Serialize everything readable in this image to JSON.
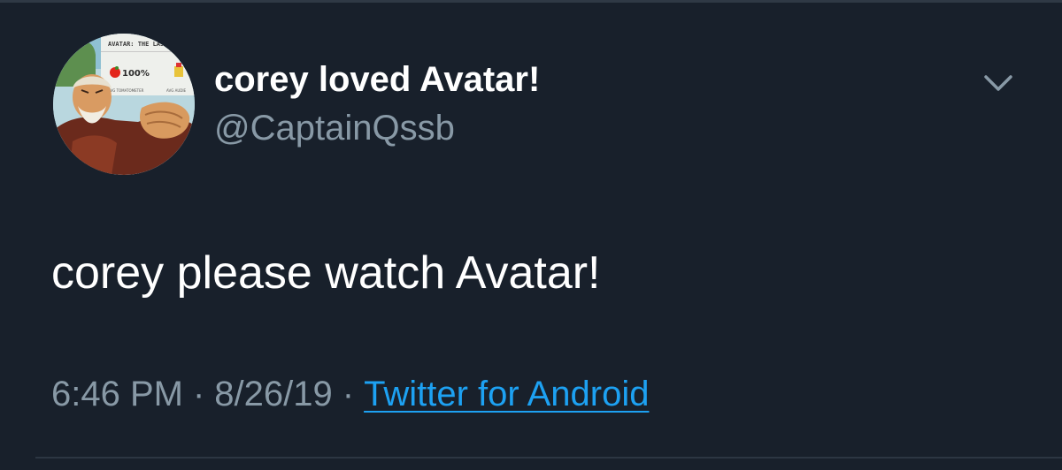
{
  "tweet": {
    "author": {
      "display_name": "corey loved Avatar!",
      "handle": "@CaptainQssb",
      "avatar_banner_title": "AVATAR: THE LAST",
      "avatar_score": "100%",
      "avatar_score_label": "AVG TOMATOMETER",
      "avatar_audience_label": "AVG AUDIE"
    },
    "text": "corey please watch Avatar!",
    "time": "6:46 PM",
    "separator": "·",
    "date": "8/26/19",
    "source": "Twitter for Android"
  },
  "icons": {
    "menu": "chevron-down-icon"
  },
  "colors": {
    "background": "#18202b",
    "primary_text": "#ffffff",
    "secondary_text": "#8899a6",
    "link": "#1da1f2"
  }
}
